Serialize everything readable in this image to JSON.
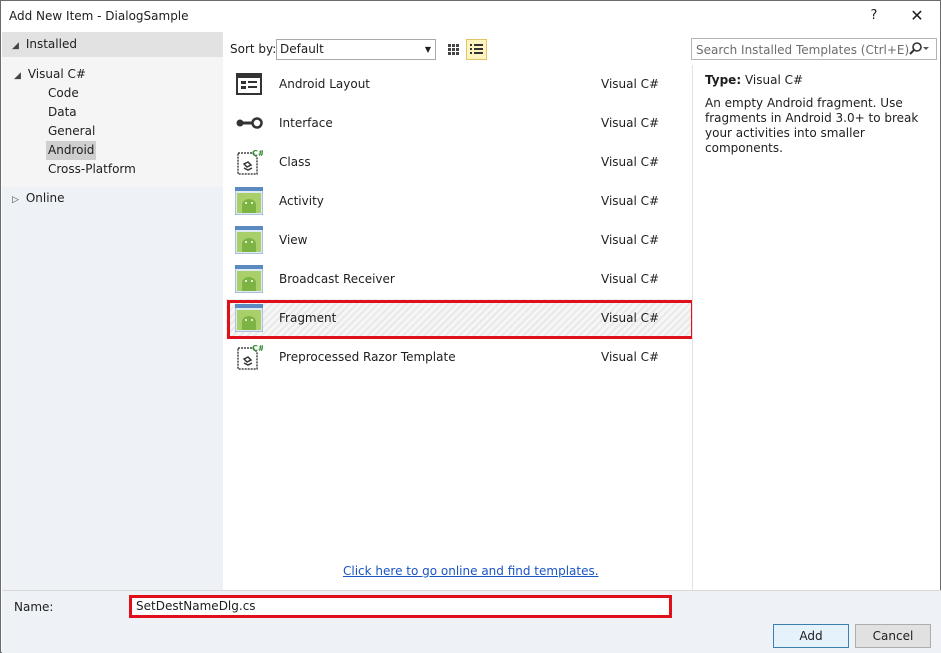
{
  "window": {
    "title": "Add New Item - DialogSample",
    "help_label": "?",
    "close_label": "✕"
  },
  "tree": {
    "installed": "Installed",
    "visual_csharp": "Visual C#",
    "children": [
      "Code",
      "Data",
      "General",
      "Android",
      "Cross-Platform"
    ],
    "selected_child": "Android",
    "online": "Online"
  },
  "toolbar": {
    "sort_label": "Sort by:",
    "sort_value": "Default",
    "search_placeholder": "Search Installed Templates (Ctrl+E)"
  },
  "templates": [
    {
      "name": "Android Layout",
      "lang": "Visual C#",
      "icon": "android-layout-icon"
    },
    {
      "name": "Interface",
      "lang": "Visual C#",
      "icon": "interface-icon"
    },
    {
      "name": "Class",
      "lang": "Visual C#",
      "icon": "csharp-class-icon"
    },
    {
      "name": "Activity",
      "lang": "Visual C#",
      "icon": "android-icon"
    },
    {
      "name": "View",
      "lang": "Visual C#",
      "icon": "android-icon"
    },
    {
      "name": "Broadcast Receiver",
      "lang": "Visual C#",
      "icon": "android-icon"
    },
    {
      "name": "Fragment",
      "lang": "Visual C#",
      "icon": "android-icon",
      "selected": true
    },
    {
      "name": "Preprocessed Razor Template",
      "lang": "Visual C#",
      "icon": "csharp-class-icon"
    }
  ],
  "online_link": "Click here to go online and find templates.",
  "details": {
    "type_label": "Type:",
    "type_value": "Visual C#",
    "description": "An empty Android fragment.  Use fragments in Android 3.0+ to break your activities into smaller components."
  },
  "bottom": {
    "name_label": "Name:",
    "name_value": "SetDestNameDlg.cs",
    "add_label": "Add",
    "cancel_label": "Cancel"
  },
  "colors": {
    "highlight_red": "#e0101a",
    "link_blue": "#1a55c4",
    "android_green": "#8dc63f"
  }
}
